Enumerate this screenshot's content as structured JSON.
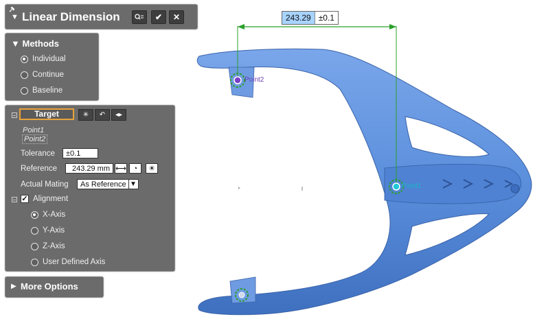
{
  "window": {
    "title": "Linear Dimension"
  },
  "toolbar": {
    "preview_icon": "preview-icon",
    "ok_icon": "checkmark-icon",
    "cancel_icon": "close-icon"
  },
  "methods": {
    "header": "Methods",
    "options": [
      {
        "label": "Individual",
        "selected": true
      },
      {
        "label": "Continue",
        "selected": false
      },
      {
        "label": "Baseline",
        "selected": false
      }
    ]
  },
  "target": {
    "button_label": "Target",
    "points": [
      "Point1",
      "Point2"
    ],
    "tolerance_label": "Tolerance",
    "tolerance_value": "±0.1",
    "reference_label": "Reference",
    "reference_value": "243.29 mm",
    "actual_mating_label": "Actual Mating",
    "actual_mating_value": "As Reference",
    "alignment_label": "Alignment",
    "alignment_checked": true,
    "axes": [
      {
        "label": "X-Axis",
        "selected": true
      },
      {
        "label": "Y-Axis",
        "selected": false
      },
      {
        "label": "Z-Axis",
        "selected": false
      },
      {
        "label": "User Defined Axis",
        "selected": false
      }
    ]
  },
  "more_options": {
    "label": "More Options"
  },
  "viewport": {
    "dimension_value": "243.29",
    "dimension_tolerance": "±0.1",
    "point_labels": [
      "Point2",
      "Point1"
    ],
    "part_color": "#5b8fdc",
    "dimension_color": "#2aa02a"
  }
}
